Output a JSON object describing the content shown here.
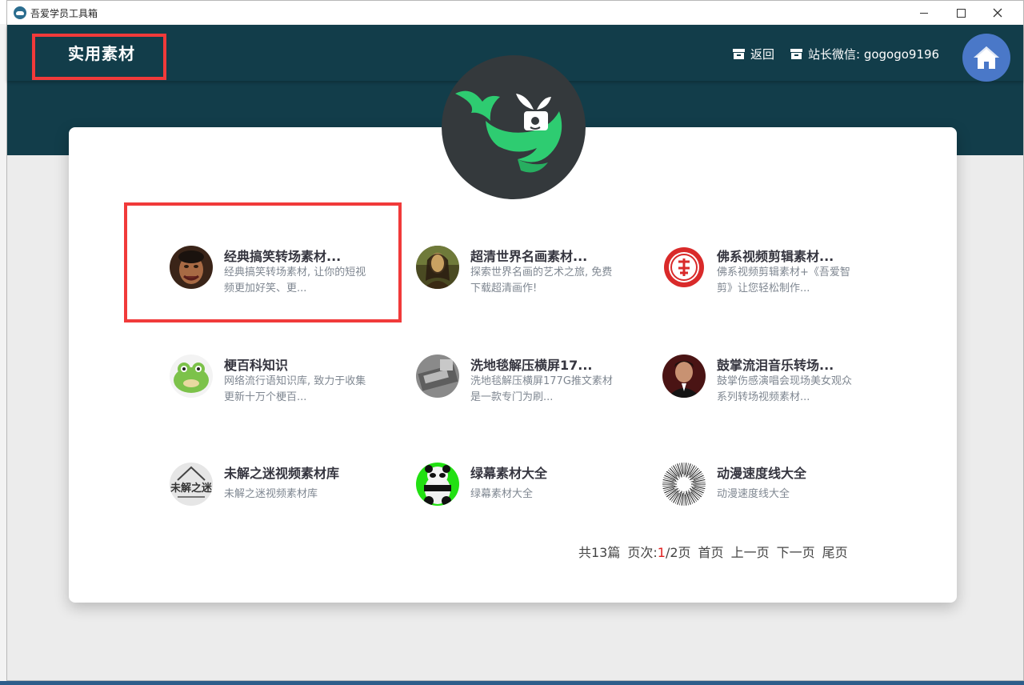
{
  "window": {
    "title": "吾爱学员工具箱"
  },
  "header": {
    "title": "实用素材",
    "back_label": "返回",
    "wechat_label": "站长微信: gogogo9196"
  },
  "items": [
    {
      "title": "经典搞笑转场素材...",
      "desc": "经典搞笑转场素材, 让你的短视频更加好笑、更..."
    },
    {
      "title": "超清世界名画素材...",
      "desc": "探索世界名画的艺术之旅, 免费下载超清画作!"
    },
    {
      "title": "佛系视频剪辑素材...",
      "desc": "佛系视频剪辑素材+《吾爱智剪》让您轻松制作..."
    },
    {
      "title": "梗百科知识",
      "desc": "网络流行语知识库, 致力于收集更新十万个梗百..."
    },
    {
      "title": "洗地毯解压横屏17...",
      "desc": "洗地毯解压横屏177G推文素材是一款专门为刷..."
    },
    {
      "title": "鼓掌流泪音乐转场...",
      "desc": "鼓掌伤感演唱会现场美女观众系列转场视频素材..."
    },
    {
      "title": "未解之迷视频素材库",
      "desc": "未解之迷视频素材库"
    },
    {
      "title": "绿幕素材大全",
      "desc": "绿幕素材大全"
    },
    {
      "title": "动漫速度线大全",
      "desc": "动漫速度线大全"
    }
  ],
  "avatar_labels": {
    "mystery": "未解之迷"
  },
  "pager": {
    "total": "共13篇",
    "page_prefix": "页次:",
    "current": "1",
    "page_suffix": "/2页",
    "first": "首页",
    "prev": "上一页",
    "next": "下一页",
    "last": "尾页"
  },
  "colors": {
    "header_bg": "#123d4a",
    "highlight": "#f13a3a",
    "home_button": "#4a78c8",
    "logo_bg": "#34393c",
    "whale_green": "#2ecc71"
  },
  "icons": {
    "back": "archive-box-icon",
    "wechat": "archive-box-icon",
    "home": "home-icon",
    "logo": "whale-logo-icon"
  }
}
